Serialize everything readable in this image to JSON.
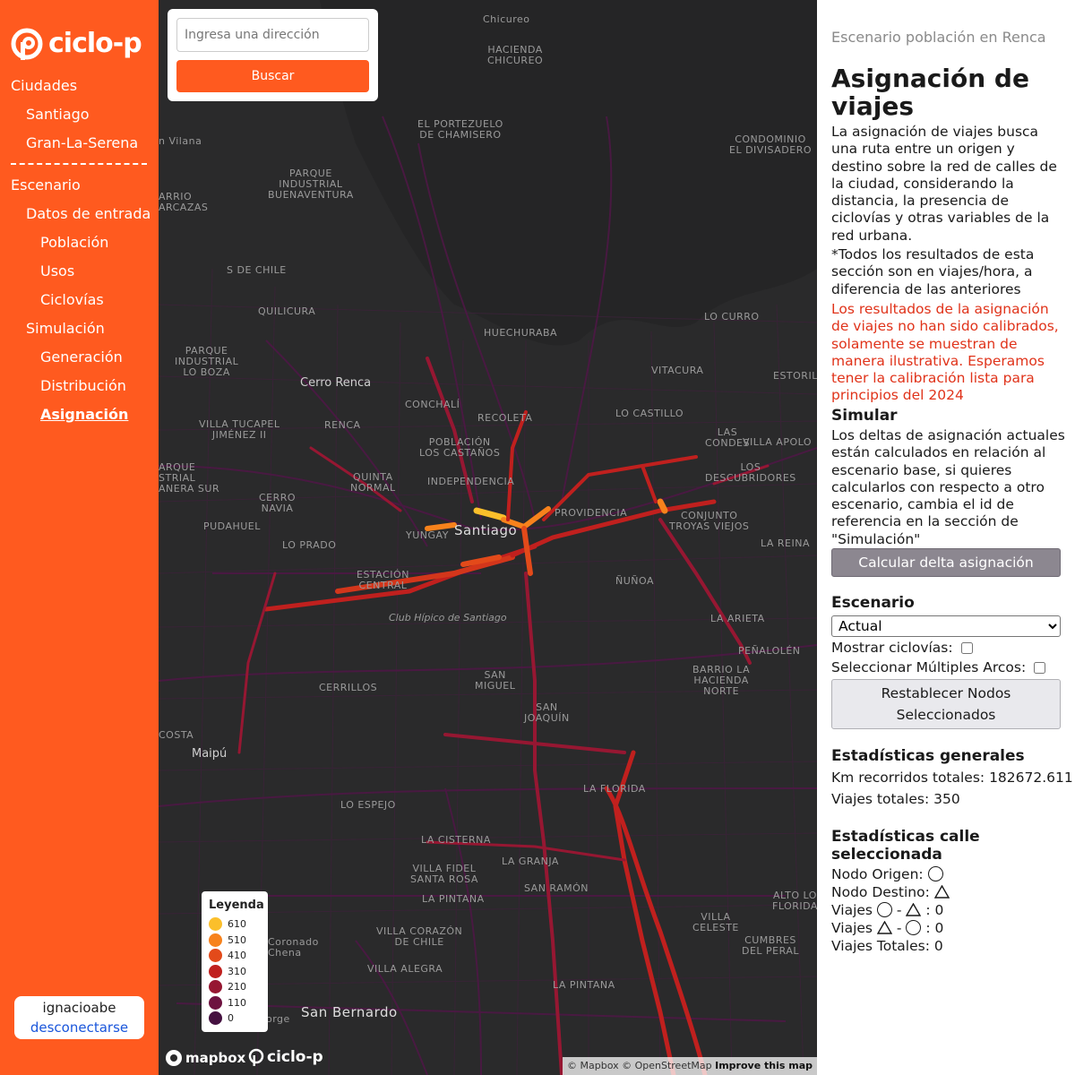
{
  "app": {
    "brand": "ciclo-p",
    "brand_color": "#ff5a1f"
  },
  "sidebar": {
    "cities_heading": "Ciudades",
    "cities": [
      {
        "label": "Santiago"
      },
      {
        "label": "Gran-La-Serena"
      }
    ],
    "scenario_heading": "Escenario",
    "input_data_heading": "Datos de entrada",
    "input_data_items": [
      {
        "label": "Población"
      },
      {
        "label": "Usos"
      },
      {
        "label": "Ciclovías"
      }
    ],
    "simulation_heading": "Simulación",
    "simulation_items": [
      {
        "label": "Generación"
      },
      {
        "label": "Distribución"
      },
      {
        "label": "Asignación",
        "active": true
      }
    ],
    "user": {
      "name": "ignacioabe",
      "logout_label": "desconectarse"
    }
  },
  "map": {
    "search": {
      "placeholder": "Ingresa una dirección",
      "value": "",
      "button_label": "Buscar"
    },
    "legend": {
      "title": "Leyenda",
      "items": [
        {
          "value": "610",
          "color": "#fbbf2b"
        },
        {
          "value": "510",
          "color": "#f7821c"
        },
        {
          "value": "410",
          "color": "#e34a1a"
        },
        {
          "value": "310",
          "color": "#c0201e"
        },
        {
          "value": "210",
          "color": "#961732"
        },
        {
          "value": "110",
          "color": "#6e1240"
        },
        {
          "value": "0",
          "color": "#451140"
        }
      ]
    },
    "place_labels": {
      "chicureo": "Chicureo",
      "hacienda_chicureo_1": "HACIENDA",
      "hacienda_chicureo_2": "CHICUREO",
      "portezuelo_1": "EL PORTEZUELO",
      "portezuelo_2": "DE CHAMISERO",
      "divisadero_1": "CONDOMINIO",
      "divisadero_2": "EL DIVISADERO",
      "vilana": "n Vilana",
      "buenaventura_1": "PARQUE",
      "buenaventura_2": "INDUSTRIAL",
      "buenaventura_3": "BUENAVENTURA",
      "arrio_1": "ARRIO",
      "arrio_2": "ARCAZAS",
      "chile_1": "S DE CHILE",
      "quilicura": "QUILICURA",
      "lo_curro": "LO CURRO",
      "huechuraba": "HUECHURABA",
      "loboza_1": "PARQUE",
      "loboza_2": "INDUSTRIAL",
      "loboza_3": "LO BOZA",
      "cerro_renca": "Cerro Renca",
      "vitacura": "VITACURA",
      "estoril": "ESTORIL",
      "conchali": "CONCHALÍ",
      "recoleta": "RECOLETA",
      "lo_castillo": "LO CASTILLO",
      "renca": "RENCA",
      "tucapel_1": "VILLA TUCAPEL",
      "tucapel_2": "JIMÉNEZ II",
      "las_condes_1": "LAS",
      "las_condes_2": "CONDES",
      "villa_apolo": "VILLA APOLO",
      "castanos_1": "POBLACIÓN",
      "castanos_2": "LOS CASTAÑOS",
      "descubridores_1": "LOS",
      "descubridores_2": "DESCUBRIDORES",
      "arque_1": "ARQUE",
      "arque_2": "STRIAL",
      "arque_3": "ANERA SUR",
      "quinta_1": "QUINTA",
      "quinta_2": "NORMAL",
      "independencia": "INDEPENDENCIA",
      "conjunto_1": "CONJUNTO",
      "conjunto_2": "TROYAS VIEJOS",
      "cerro_navia_1": "CERRO",
      "cerro_navia_2": "NAVIA",
      "yungay": "YUNGAY",
      "santiago": "Santiago",
      "providencia": "PROVIDENCIA",
      "pudahuel": "PUDAHUEL",
      "lo_prado": "LO PRADO",
      "la_reina": "LA REINA",
      "estacion_1": "ESTACIÓN",
      "estacion_2": "CENTRAL",
      "nunoa": "ÑUÑOA",
      "club_hipico": "Club Hípico de Santiago",
      "la_reina_bottom": "LA ARIETA",
      "penalolen": "PEÑALOLÉN",
      "san_miguel_1": "SAN",
      "san_miguel_2": "MIGUEL",
      "barrio_1": "BARRIO LA",
      "barrio_2": "HACIENDA",
      "barrio_3": "NORTE",
      "cerrillos": "CERRILLOS",
      "san_joaquin_1": "SAN",
      "san_joaquin_2": "JOAQUÍN",
      "maipu": "Maipú",
      "la_florida": "LA FLORIDA",
      "lo_espejo": "LO ESPEJO",
      "la_cisterna": "LA CISTERNA",
      "la_granja_1": "LA GRANJA",
      "villa_fidel_1": "VILLA FIDEL",
      "villa_fidel_2": "SANTA ROSA",
      "san_ramon": "SAN RAMÓN",
      "alto_1": "ALTO LO",
      "alto_2": "FLORIDA",
      "celeste_1": "VILLA",
      "celeste_2": "CELESTE",
      "la_pintana_1": "LA PINTANA",
      "cumbres_1": "CUMBRES",
      "cumbres_2": "DEL PERAL",
      "villa_corazon_1": "VILLA CORAZÓN",
      "villa_corazon_2": "DE CHILE",
      "coronado_1": "Coronado",
      "coronado_2": "Chena",
      "villa_alegra": "VILLA ALEGRA",
      "san_bernardo": "San Bernardo",
      "la_platina": "LA PINTANA",
      "costa": "COSTA",
      "orge": "orge"
    },
    "mapbox_label": "mapbox",
    "attribution": "© Mapbox © OpenStreetMap",
    "attribution_improve": "Improve this map"
  },
  "panel": {
    "scenario_label": "Escenario población en Renca",
    "title": "Asignación de viajes",
    "description": "La asignación de viajes busca una ruta entre un origen y destino sobre la red de calles de la ciudad, considerando la distancia, la presencia de ciclovías y otras variables de la red urbana.",
    "note": "*Todos los resultados de esta sección son en viajes/hora, a diferencia de las anteriores",
    "warning": "Los resultados de la asignación de viajes no han sido calibrados, solamente se muestran de manera ilustrativa. Esperamos tener la calibración lista para principios del 2024",
    "warning_color": "#e0331a",
    "simulate_heading": "Simular",
    "simulate_text": "Los deltas de asignación actuales están calculados en relación al escenario base, si quieres calcularlos con respecto a otro escenario, cambia el id de referencia en la sección de \"Simulación\"",
    "calc_delta_label": "Calcular delta asignación",
    "scenario_heading": "Escenario",
    "scenario_selected": "Actual",
    "show_bikelanes_label": "Mostrar ciclovías:",
    "show_bikelanes_checked": false,
    "multi_arcs_label": "Seleccionar Múltiples Arcos:",
    "multi_arcs_checked": false,
    "reset_nodes_label": "Restablecer Nodos Seleccionados",
    "general_stats_heading": "Estadísticas generales",
    "km_total_label": "Km recorridos totales: 182672.611",
    "trips_total_label": "Viajes totales: 350",
    "street_stats_heading": "Estadísticas calle seleccionada",
    "origin_node_label": "Nodo Origen:",
    "dest_node_label": "Nodo Destino:",
    "trips_label": "Viajes",
    "trips_od_value": ": 0",
    "trips_do_value": ": 0",
    "trips_total_sel_label": "Viajes Totales: 0"
  }
}
